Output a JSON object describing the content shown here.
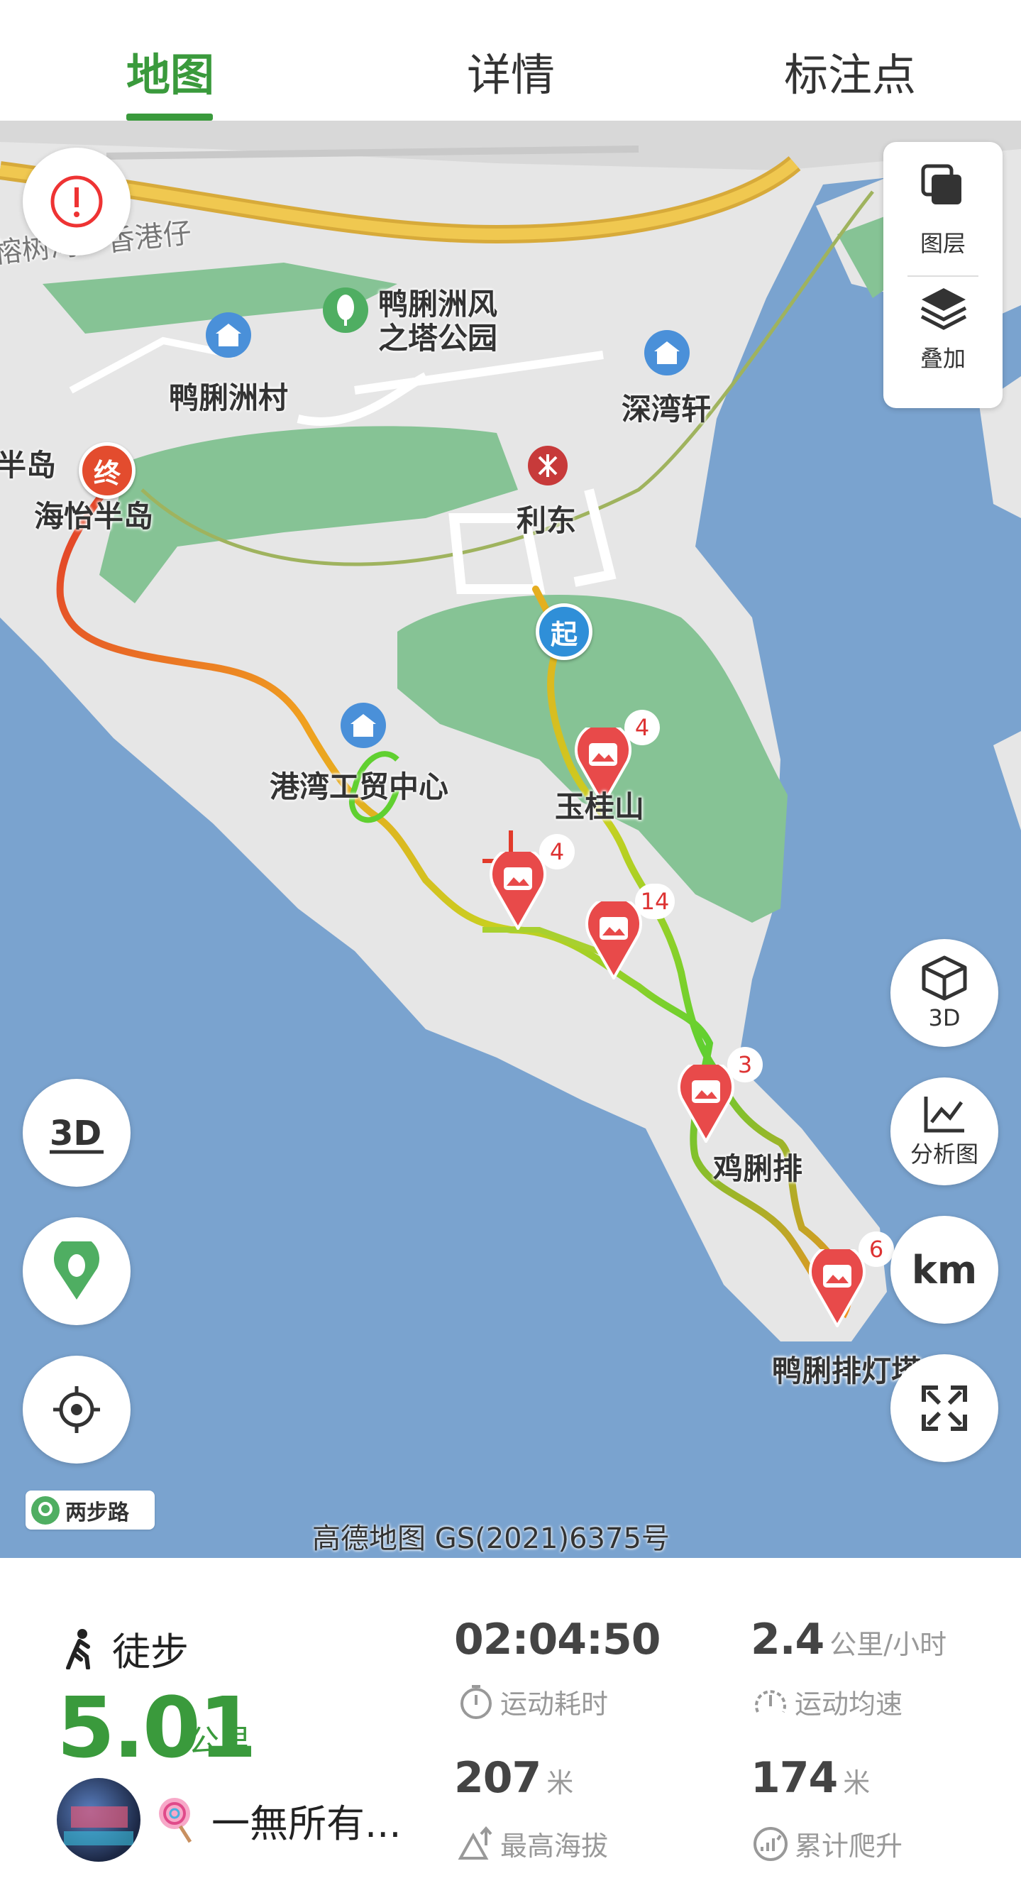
{
  "tabs": {
    "map": "地图",
    "detail": "详情",
    "marks": "标注点"
  },
  "map": {
    "labels": {
      "rongshuwan": "榕树湾 - 香港仔",
      "park_line1": "鸭脷洲风",
      "park_line2": "之塔公园",
      "village": "鸭脷洲村",
      "shenwan": "深湾轩",
      "peninsula_edge": "半岛",
      "haiyi": "海怡半岛",
      "lidong": "利东",
      "gangwan": "港湾工贸中心",
      "yumao": "玉桂山",
      "jipai": "鸡脷排",
      "lighthouse": "鸭脷排灯塔"
    },
    "markers": {
      "start": "起",
      "end": "终"
    },
    "photo_counts": [
      "4",
      "4",
      "14",
      "3",
      "6"
    ],
    "buttons": {
      "layer": "图层",
      "overlay": "叠加",
      "three_d": "3D",
      "analysis": "分析图",
      "km": "km"
    },
    "brand": "两步路",
    "watermark": "高德地图 GS(2021)6375号"
  },
  "stats": {
    "sport": "徒步",
    "distance": "5.01",
    "distance_unit": "公里",
    "duration": "02:04:50",
    "duration_label": "运动耗时",
    "speed": "2.4",
    "speed_unit": "公里/小时",
    "speed_label": "运动均速",
    "max_alt": "207",
    "max_alt_unit": "米",
    "max_alt_label": "最高海拔",
    "climb": "174",
    "climb_unit": "米",
    "climb_label": "累计爬升",
    "username": "一無所有..."
  },
  "colors": {
    "accent": "#3a9a3c",
    "water": "#7aa3cf",
    "land": "#e6e6e6",
    "park": "#86c395",
    "marker": "#e84a4a"
  }
}
